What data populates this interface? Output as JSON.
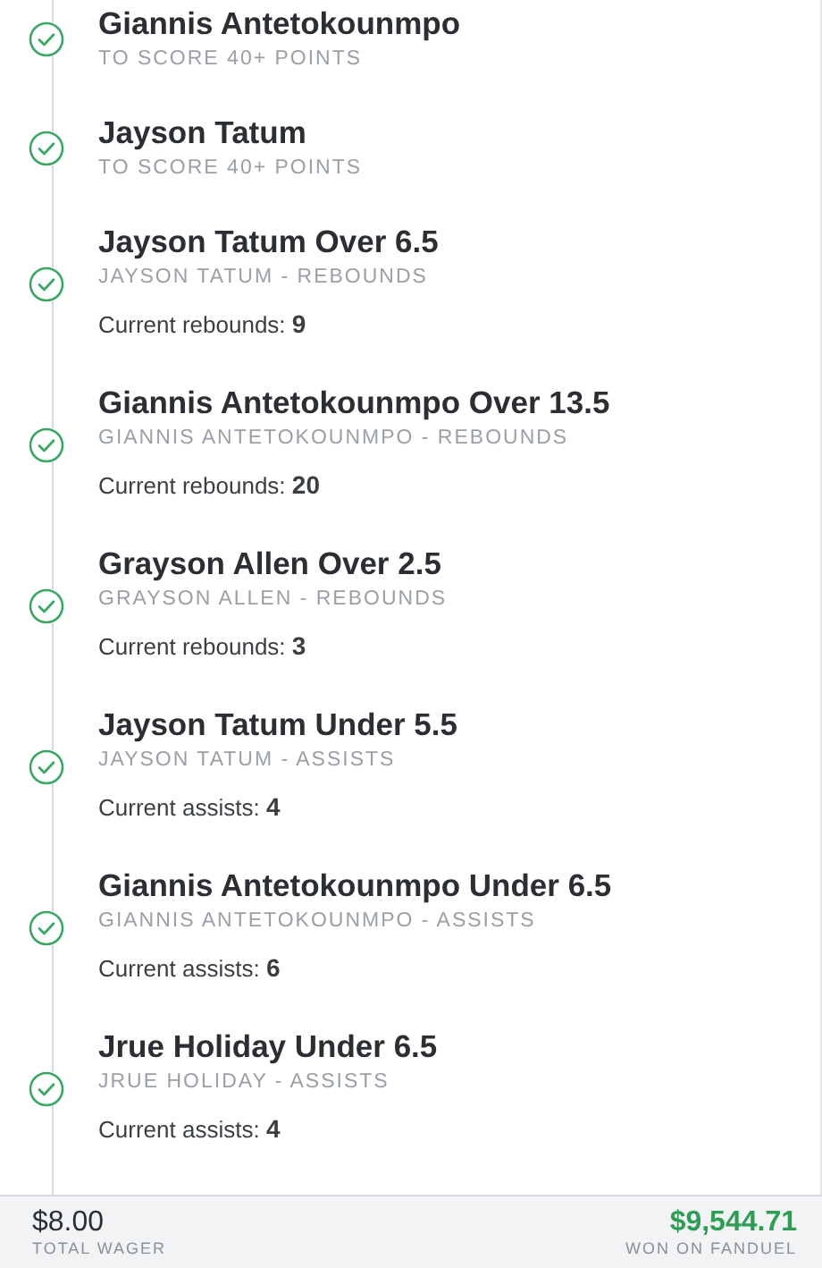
{
  "legs": [
    {
      "title": "Giannis Antetokounmpo",
      "market": "TO SCORE 40+ POINTS",
      "won": true
    },
    {
      "title": "Jayson Tatum",
      "market": "TO SCORE 40+ POINTS",
      "won": true
    },
    {
      "title": "Jayson Tatum Over 6.5",
      "market": "JAYSON TATUM - REBOUNDS",
      "won": true,
      "stat_label": "Current rebounds:",
      "stat_value": "9"
    },
    {
      "title": "Giannis Antetokounmpo Over 13.5",
      "market": "GIANNIS ANTETOKOUNMPO - REBOUNDS",
      "won": true,
      "stat_label": "Current rebounds:",
      "stat_value": "20"
    },
    {
      "title": "Grayson Allen Over 2.5",
      "market": "GRAYSON ALLEN - REBOUNDS",
      "won": true,
      "stat_label": "Current rebounds:",
      "stat_value": "3"
    },
    {
      "title": "Jayson Tatum Under 5.5",
      "market": "JAYSON TATUM - ASSISTS",
      "won": true,
      "stat_label": "Current assists:",
      "stat_value": "4"
    },
    {
      "title": "Giannis Antetokounmpo Under 6.5",
      "market": "GIANNIS ANTETOKOUNMPO - ASSISTS",
      "won": true,
      "stat_label": "Current assists:",
      "stat_value": "6"
    },
    {
      "title": "Jrue Holiday Under 6.5",
      "market": "JRUE HOLIDAY - ASSISTS",
      "won": true,
      "stat_label": "Current assists:",
      "stat_value": "4"
    }
  ],
  "footer": {
    "wager": "$8.00",
    "wager_label": "TOTAL WAGER",
    "payout": "$9,544.71",
    "payout_label": "WON ON FANDUEL"
  }
}
